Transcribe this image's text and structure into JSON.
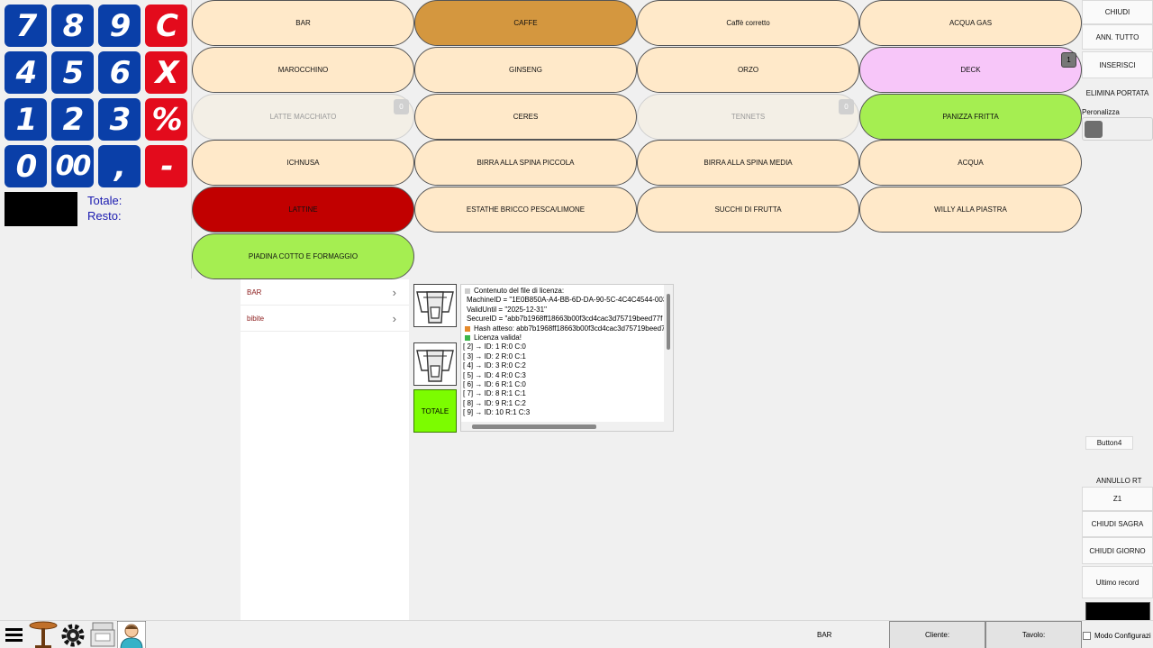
{
  "keypad": {
    "rows": [
      [
        "7",
        "8",
        "9",
        "C"
      ],
      [
        "4",
        "5",
        "6",
        "X"
      ],
      [
        "1",
        "2",
        "3",
        "%"
      ],
      [
        "0",
        "00",
        ",",
        "-"
      ]
    ],
    "totale_label": "Totale:",
    "resto_label": "Resto:"
  },
  "products": {
    "r0": [
      "BAR",
      "CAFFE",
      "Caffè corretto",
      "ACQUA GAS"
    ],
    "r1": [
      "MAROCCHINO",
      "GINSENG",
      "ORZO",
      "DECK"
    ],
    "r2": [
      "LATTE MACCHIATO",
      "CERES",
      "TENNETS",
      "PANIZZA FRITTA"
    ],
    "r3": [
      "ICHNUSA",
      "BIRRA ALLA SPINA PICCOLA",
      "BIRRA ALLA SPINA MEDIA",
      "ACQUA"
    ],
    "r4": [
      "LATTINE",
      "ESTATHE BRICCO PESCA/LIMONE",
      "SUCCHI DI FRUTTA",
      "WILLY ALLA PIASTRA"
    ],
    "r5": [
      "PIADINA COTTO E FORMAGGIO"
    ],
    "badges": {
      "deck": "1",
      "latte": "0",
      "tennets": "0"
    }
  },
  "commands": {
    "chiudi": "CHIUDI",
    "ann_tutto": "ANN. TUTTO",
    "inserisci": "INSERISCI",
    "elimina_portata": "ELIMINA PORTATA",
    "peronalizza": "Peronalizza",
    "button4": "Button4",
    "annullo_rt": "ANNULLO RT",
    "z1": "Z1",
    "chiudi_sagra": "CHIUDI SAGRA",
    "chiudi_giorno": "CHIUDI GIORNO",
    "ultimo_record": "Ultimo record",
    "modo_configurazione": "Modo Configurazi"
  },
  "categories": [
    "BAR",
    "bibite"
  ],
  "tiles": {
    "totale": "TOTALE"
  },
  "log": {
    "lines": [
      "Contenuto del file di licenza:",
      "MachineID  = \"1E0B850A-A4-BB-6D-DA-90-5C-4C4C4544-003",
      "ValidUntil = \"2025-12-31\"",
      "SecureID   = \"abb7b1968ff18663b00f3cd4cac3d75719beed77f",
      "Hash atteso: abb7b1968ff18663b00f3cd4cac3d75719beed7",
      "Licenza valida!",
      "[ 2] → ID:  1  R:0 C:0",
      "[ 3] → ID:  2  R:0 C:1",
      "[ 4] → ID:  3  R:0 C:2",
      "[ 5] → ID:  4  R:0 C:3",
      "[ 6] → ID:  6  R:1 C:0",
      "[ 7] → ID:  8  R:1 C:1",
      "[ 8] → ID:  9  R:1 C:2",
      "[ 9] → ID:  10  R:1 C:3"
    ]
  },
  "bottom": {
    "bar_label": "BAR",
    "cliente_label": "Cliente:",
    "tavolo_label": "Tavolo:"
  },
  "colors": {
    "key_blue": "#0a3fa8",
    "key_red": "#e30b1c",
    "product_default": "#ffe9c9",
    "caffe": "#d4973f",
    "deck": "#f7c6f9",
    "green": "#a5ee51",
    "lattine": "#c10000",
    "totale_tile": "#7cfc00"
  }
}
